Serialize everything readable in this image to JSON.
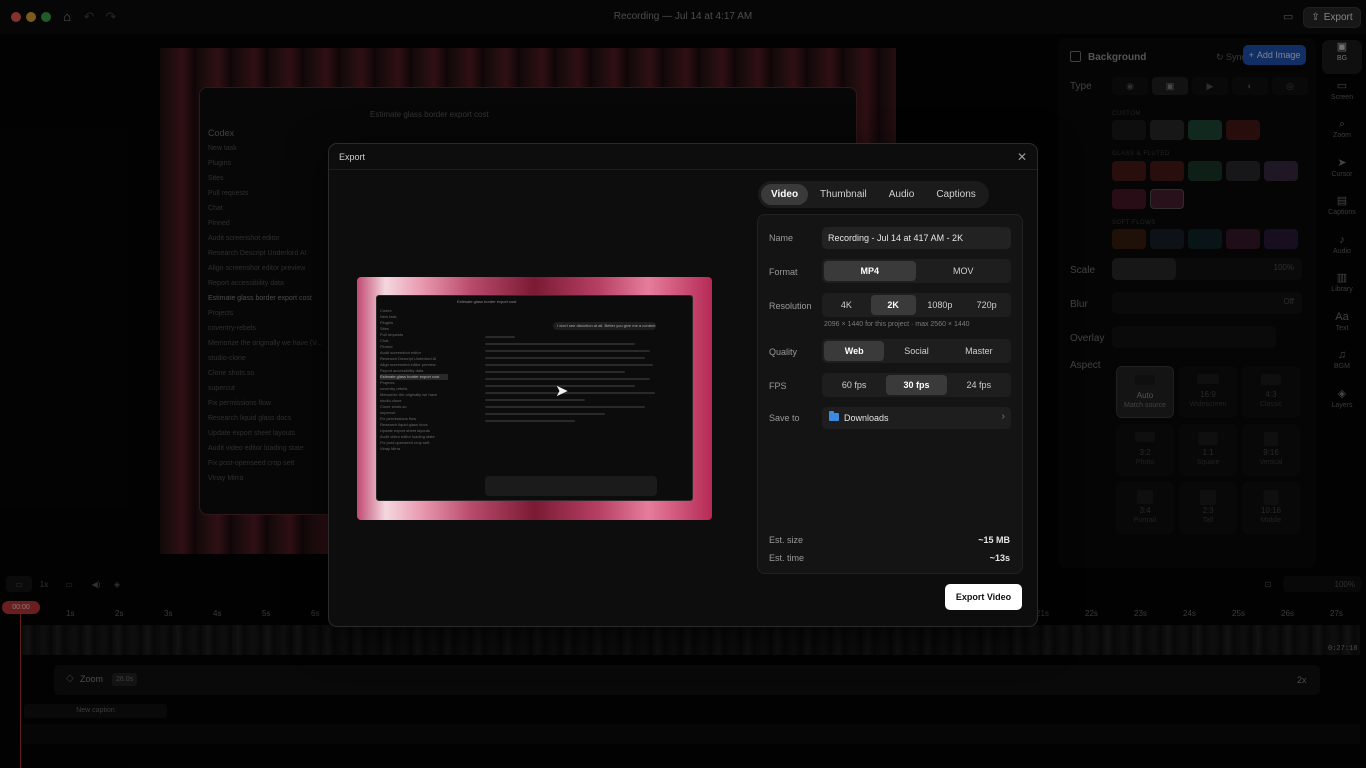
{
  "window": {
    "title": "Recording — Jul 14 at 4:17 AM",
    "export_label": "Export"
  },
  "canvas_window": {
    "title": "Estimate glass border export cost",
    "sidebar": [
      "Codex",
      "New task",
      "Plugins",
      "Sites",
      "Pull requests",
      "Chat",
      "Pinned",
      "Audit screenshot editor",
      "Research Descript Underlord AI",
      "Align screenshot editor preview",
      "Report accessibility data",
      "Estimate glass border export cost",
      "Projects",
      "coventry-rebels",
      "Memorize the originally we have (V...",
      "studio-clone",
      "Clone shots.so",
      "supercut",
      "Fix permissions flow",
      "Research liquid glass docs",
      "Update export sheet layouts",
      "Audit video editor loading state",
      "Fix post-openseed crop sett",
      "Vinay Mirra"
    ]
  },
  "right_panel": {
    "title": "Background",
    "sync_label": "Sync",
    "add_image_label": "Add Image",
    "type_label": "Type",
    "sections": [
      "CUSTOM",
      "GLASS & FLUTED",
      "SOFT FLOWS"
    ],
    "scale_label": "Scale",
    "scale_value": "100%",
    "blur_label": "Blur",
    "blur_value": "Off",
    "overlay_label": "Overlay",
    "aspect_label": "Aspect",
    "aspects": [
      {
        "ratio": "Auto",
        "name": "Match source"
      },
      {
        "ratio": "16:9",
        "name": "Widescreen"
      },
      {
        "ratio": "4:3",
        "name": "Classic"
      },
      {
        "ratio": "3:2",
        "name": "Photo"
      },
      {
        "ratio": "1:1",
        "name": "Square"
      },
      {
        "ratio": "9:16",
        "name": "Vertical"
      },
      {
        "ratio": "3:4",
        "name": "Portrait"
      },
      {
        "ratio": "2:3",
        "name": "Tall"
      },
      {
        "ratio": "10:16",
        "name": "Mobile"
      }
    ]
  },
  "toolbar": [
    {
      "label": "BG",
      "icon": "image-icon"
    },
    {
      "label": "Screen",
      "icon": "screen-icon"
    },
    {
      "label": "Zoom",
      "icon": "zoom-icon"
    },
    {
      "label": "Cursor",
      "icon": "cursor-icon"
    },
    {
      "label": "Captions",
      "icon": "captions-icon"
    },
    {
      "label": "Audio",
      "icon": "audio-icon"
    },
    {
      "label": "Library",
      "icon": "library-icon"
    },
    {
      "label": "Text",
      "icon": "text-icon"
    },
    {
      "label": "BGM",
      "icon": "music-icon"
    },
    {
      "label": "Layers",
      "icon": "layers-icon"
    }
  ],
  "timeline": {
    "speed": "1x",
    "zoom_percent": "100%",
    "playhead_time": "00:00",
    "end_time": "0:27:18",
    "ticks_left": [
      "1s",
      "2s",
      "3s",
      "4s",
      "5s",
      "6s"
    ],
    "ticks_right": [
      "21s",
      "22s",
      "23s",
      "24s",
      "25s",
      "26s",
      "27s"
    ],
    "zoom_track_label": "Zoom",
    "zoom_track_duration": "26.0s",
    "zoom_track_factor": "2x",
    "caption_label": "New caption"
  },
  "export_modal": {
    "title": "Export",
    "tabs": [
      "Video",
      "Thumbnail",
      "Audio",
      "Captions"
    ],
    "active_tab": "Video",
    "name_label": "Name",
    "name_value": "Recording - Jul 14 at 417 AM - 2K",
    "format_label": "Format",
    "format_options": [
      "MP4",
      "MOV"
    ],
    "format_selected": "MP4",
    "resolution_label": "Resolution",
    "resolution_options": [
      "4K",
      "2K",
      "1080p",
      "720p"
    ],
    "resolution_selected": "2K",
    "resolution_note": "2096 × 1440 for this project · max 2560 × 1440",
    "quality_label": "Quality",
    "quality_options": [
      "Web",
      "Social",
      "Master"
    ],
    "quality_selected": "Web",
    "fps_label": "FPS",
    "fps_options": [
      "60 fps",
      "30 fps",
      "24 fps"
    ],
    "fps_selected": "30 fps",
    "save_label": "Save to",
    "save_value": "Downloads",
    "est_size_label": "Est. size",
    "est_size_value": "~15 MB",
    "est_time_label": "Est. time",
    "est_time_value": "~13s",
    "export_button": "Export Video"
  },
  "preview": {
    "title": "Estimate glass border export cost",
    "bubble": "I don't see distortion at all. Better you give me a content for them?",
    "sidebar": [
      "Codex",
      "New task",
      "Plugins",
      "Sites",
      "Pull requests",
      "Chat",
      "Pinned",
      "Audit screenshot editor",
      "Research Descript Underlord AI",
      "Align screenshot editor preview",
      "Report accessibility data",
      "Estimate glass border export cost",
      "Projects",
      "coventry-rebels",
      "Memorize the originally we have",
      "studio-clone",
      "Clone shots.so",
      "supercut",
      "Fix permissions flow",
      "Research liquid glass docs",
      "Update export sheet layouts",
      "Audit video editor loading state",
      "Fix post-openseed crop sett",
      "Vinay Mirra"
    ]
  },
  "colors": {
    "accent_blue": "#1f55b8",
    "playhead": "#c0393a",
    "export_button": "#ffffff"
  }
}
